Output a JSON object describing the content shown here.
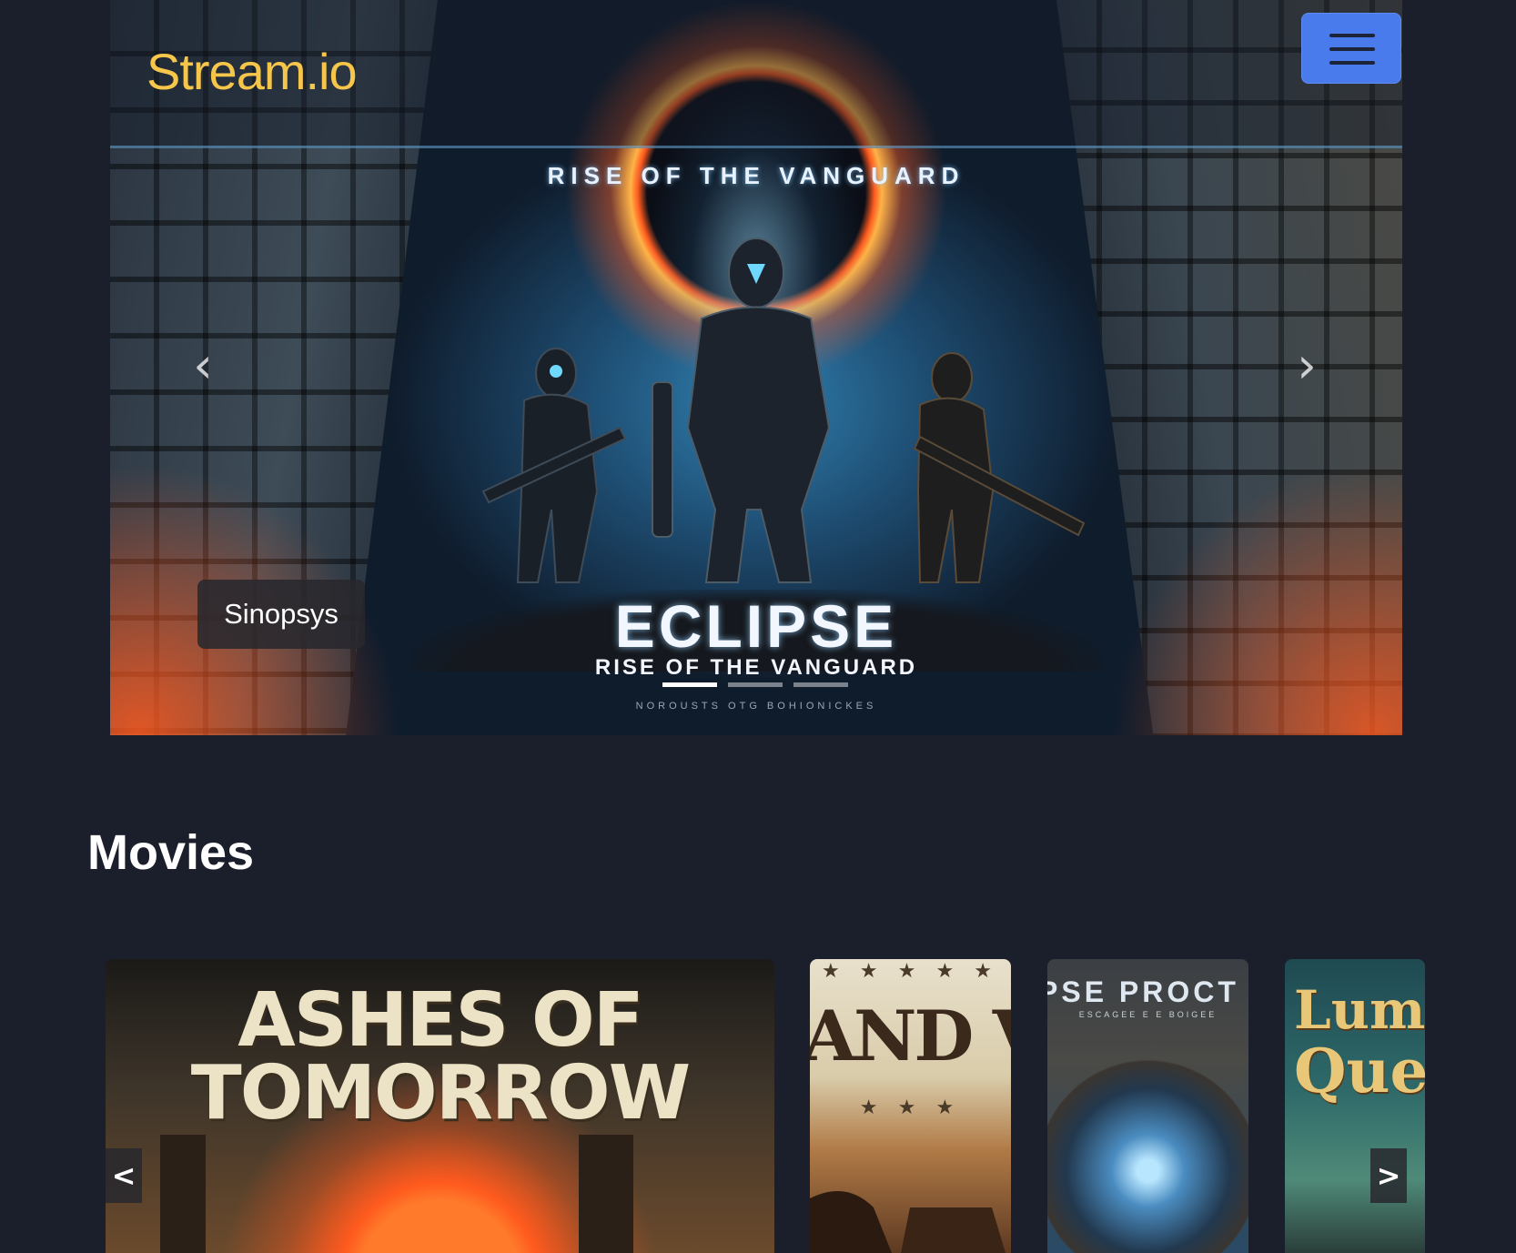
{
  "app": {
    "logo": "Stream.io",
    "accent_color": "#f5c64a",
    "menu_button_color": "#4a7bec",
    "menu_icon": "hamburger-icon"
  },
  "hero": {
    "poster_top_title": "RISE OF THE VANGUARD",
    "poster_title": "ECLIPSE",
    "poster_subtitle": "RISE OF THE VANGUARD",
    "poster_tagline": "NOROUSTS OTG BOHIONICKES",
    "synopsis_button": "Sinopsys",
    "prev_icon": "chevron-left-icon",
    "next_icon": "chevron-right-icon",
    "prev_glyph": "‹",
    "next_glyph": "›",
    "slides_count": 3,
    "active_slide": 1
  },
  "movies": {
    "section_title": "Movies",
    "prev_label": "<",
    "next_label": ">",
    "cards": [
      {
        "title_line1": "ASHES OF",
        "title_line2": "TOMORROW"
      },
      {
        "visible_title": "AND VENG"
      },
      {
        "visible_title": "PSE PROCT",
        "visible_subtitle": "ESCAGEE E E BOIGEE"
      },
      {
        "visible_title_line1": "Lumin",
        "visible_title_line2": "Que"
      }
    ]
  }
}
